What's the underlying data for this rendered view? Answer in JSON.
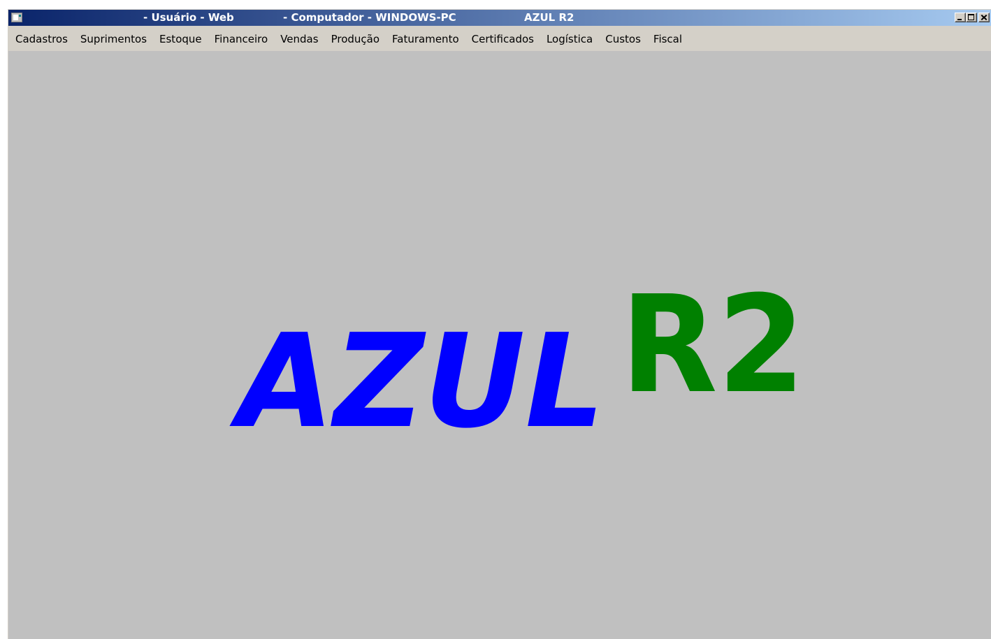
{
  "titlebar": {
    "icon": "app-window-icon",
    "user": "- Usuário - Web",
    "computer": "- Computador - WINDOWS-PC",
    "app_name": "AZUL R2",
    "gradient": [
      "#0A246A",
      "#A6CAF0"
    ],
    "controls": [
      "minimize-icon",
      "maximize-icon",
      "close-icon"
    ]
  },
  "menu": {
    "items": [
      "Cadastros",
      "Suprimentos",
      "Estoque",
      "Financeiro",
      "Vendas",
      "Produção",
      "Faturamento",
      "Certificados",
      "Logística",
      "Custos",
      "Fiscal"
    ]
  },
  "logo": {
    "word": "AZUL",
    "suffix": "R2",
    "word_color": "#0000FF",
    "suffix_color": "#008000"
  },
  "colors": {
    "window": "#D4D0C8",
    "workspace": "#C0C0C0"
  }
}
